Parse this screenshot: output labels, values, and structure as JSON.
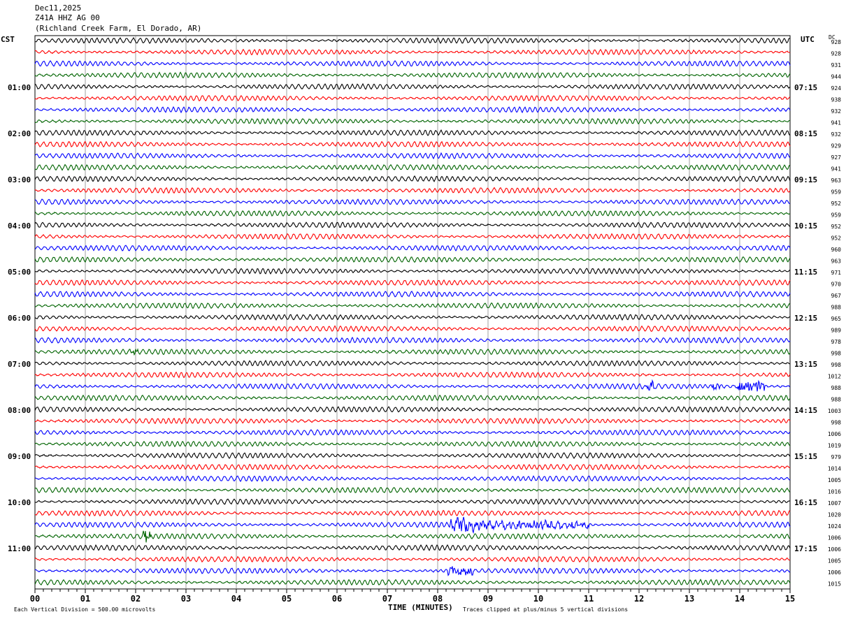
{
  "header": {
    "date": "Dec11,2025",
    "station": "Z41A HHZ AG 00",
    "location": "(Richland Creek Farm, El Dorado, AR)"
  },
  "left_tz": "CST",
  "right_tz": "UTC",
  "dc_label": "DC",
  "footer": {
    "scale": "Each Vertical Division =  500.00 microvolts",
    "xlabel": "TIME (MINUTES)",
    "clip": "Traces clipped at plus/minus 5 vertical divisions"
  },
  "chart_data": {
    "type": "line",
    "title": "Z41A HHZ AG 00 helicorder",
    "xlabel": "TIME (MINUTES)",
    "xlim": [
      0,
      15
    ],
    "x_ticks": [
      "00",
      "01",
      "02",
      "03",
      "04",
      "05",
      "06",
      "07",
      "08",
      "09",
      "10",
      "11",
      "12",
      "13",
      "14",
      "15"
    ],
    "trace_colors": [
      "#000000",
      "#ff0000",
      "#0000ff",
      "#006400"
    ],
    "left_labels": [
      "",
      "01:00",
      "02:00",
      "03:00",
      "04:00",
      "05:00",
      "06:00",
      "07:00",
      "08:00",
      "09:00",
      "10:00",
      "11:00"
    ],
    "right_labels": [
      "",
      "07:15",
      "08:15",
      "09:15",
      "10:15",
      "11:15",
      "12:15",
      "13:15",
      "14:15",
      "15:15",
      "16:15",
      "17:15"
    ],
    "dc_values": [
      "928",
      "928",
      "931",
      "944",
      "924",
      "938",
      "932",
      "941",
      "932",
      "929",
      "927",
      "941",
      "963",
      "959",
      "952",
      "959",
      "952",
      "952",
      "960",
      "963",
      "971",
      "970",
      "967",
      "988",
      "965",
      "989",
      "978",
      "998",
      "998",
      "1012",
      "988",
      "988",
      "1003",
      "998",
      "1006",
      "1019",
      "979",
      "1014",
      "1005",
      "1016",
      "1007",
      "1020",
      "1024",
      "1006",
      "1006",
      "1005",
      "1006",
      "1015"
    ],
    "events": [
      {
        "trace": 30,
        "start_min": 12.1,
        "end_min": 12.3,
        "amp": 1.6
      },
      {
        "trace": 30,
        "start_min": 13.45,
        "end_min": 13.6,
        "amp": 1.8
      },
      {
        "trace": 30,
        "start_min": 13.95,
        "end_min": 14.5,
        "amp": 2.0
      },
      {
        "trace": 42,
        "start_min": 8.25,
        "end_min": 8.9,
        "amp": 2.6
      },
      {
        "trace": 42,
        "start_min": 8.9,
        "end_min": 11.0,
        "amp": 1.3
      },
      {
        "trace": 43,
        "start_min": 2.15,
        "end_min": 2.3,
        "amp": 2.2
      },
      {
        "trace": 46,
        "start_min": 8.2,
        "end_min": 8.7,
        "amp": 1.6
      },
      {
        "trace": 27,
        "start_min": 1.9,
        "end_min": 2.05,
        "amp": 1.5
      }
    ]
  }
}
